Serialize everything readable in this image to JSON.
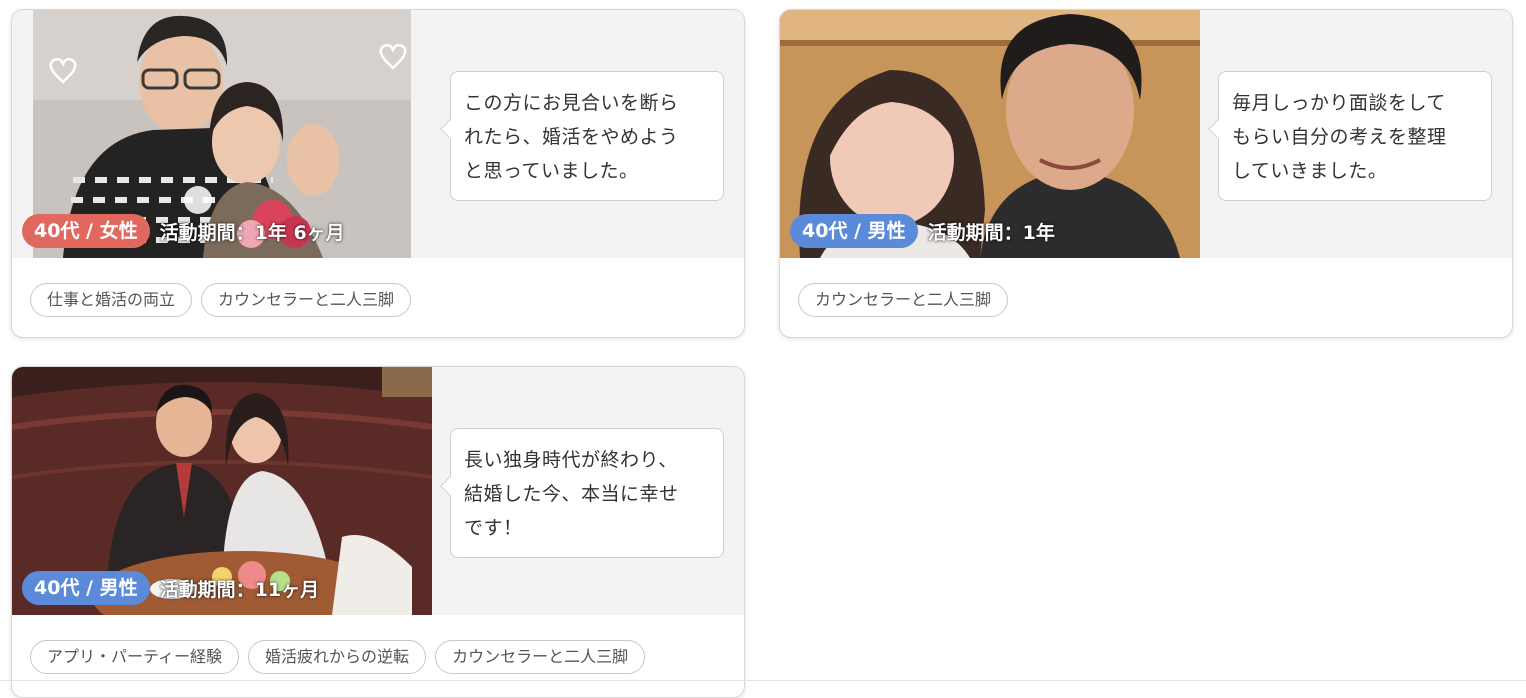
{
  "colors": {
    "female_badge": "#e0685f",
    "male_badge": "#5b8ad8",
    "card_top_bg": "#f3f3f3"
  },
  "cards": [
    {
      "quote_lines": [
        "この方にお見合いを断ら",
        "れたら、婚活をやめよう",
        "と思っていました。"
      ],
      "badge": "40代 / 女性",
      "period": "活動期間：1年 6ヶ月",
      "tags": [
        "仕事と婚活の両立",
        "カウンセラーと二人三脚"
      ]
    },
    {
      "quote_lines": [
        "毎月しっかり面談をして",
        "もらい自分の考えを整理",
        "していきました。"
      ],
      "badge": "40代 / 男性",
      "period": "活動期間：1年",
      "tags": [
        "カウンセラーと二人三脚"
      ]
    },
    {
      "quote_lines": [
        "長い独身時代が終わり、",
        "結婚した今、本当に幸せ",
        "です！"
      ],
      "badge": "40代 / 男性",
      "period": "活動期間：11ヶ月",
      "tags": [
        "アプリ・パーティー経験",
        "婚活疲れからの逆転",
        "カウンセラーと二人三脚"
      ]
    }
  ]
}
